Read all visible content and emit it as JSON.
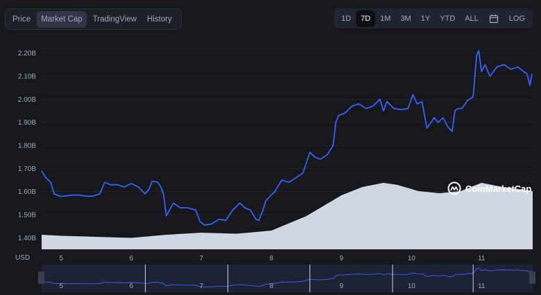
{
  "tabs": [
    {
      "label": "Price",
      "active": false
    },
    {
      "label": "Market Cap",
      "active": true
    },
    {
      "label": "TradingView",
      "active": false
    },
    {
      "label": "History",
      "active": false
    }
  ],
  "ranges": [
    "1D",
    "7D",
    "1M",
    "3M",
    "1Y",
    "YTD",
    "ALL"
  ],
  "active_range": "7D",
  "log_label": "LOG",
  "brand": "CoinMarketCap",
  "currency_label": "USD",
  "colors": {
    "line": "#3861fb",
    "volume": "#cfd6e4",
    "grid": "#23262e",
    "background": "#17181b"
  },
  "chart_data": {
    "type": "line",
    "y_unit": "B",
    "ylim": [
      1.35,
      2.25
    ],
    "y_ticks": [
      "2.20B",
      "2.10B",
      "2.00B",
      "1.90B",
      "1.80B",
      "1.70B",
      "1.60B",
      "1.50B",
      "1.40B"
    ],
    "y_tick_values": [
      2.2,
      2.1,
      2.0,
      1.9,
      1.8,
      1.7,
      1.6,
      1.5,
      1.4
    ],
    "x_ticks": [
      "5",
      "6",
      "7",
      "8",
      "9",
      "10",
      "11"
    ],
    "x_tick_values": [
      5,
      6,
      7,
      8,
      9,
      10,
      11
    ],
    "xlim": [
      4.72,
      11.73
    ],
    "series": [
      {
        "x": [
          4.72,
          4.78,
          4.85,
          4.9,
          4.98,
          5.05,
          5.15,
          5.25,
          5.35,
          5.45,
          5.55,
          5.62,
          5.7,
          5.8,
          5.9,
          6.0,
          6.1,
          6.2,
          6.25,
          6.3,
          6.38,
          6.42,
          6.46,
          6.5,
          6.6,
          6.7,
          6.8,
          6.92,
          6.98,
          7.05,
          7.15,
          7.25,
          7.35,
          7.45,
          7.55,
          7.62,
          7.7,
          7.78,
          7.82,
          7.88,
          7.92,
          7.98,
          8.05,
          8.15,
          8.25,
          8.35,
          8.45,
          8.55,
          8.62,
          8.7,
          8.8,
          8.88,
          8.92,
          8.96,
          9.05,
          9.15,
          9.25,
          9.35,
          9.45,
          9.55,
          9.6,
          9.65,
          9.75,
          9.85,
          9.95,
          10.02,
          10.08,
          10.15,
          10.22,
          10.28,
          10.32,
          10.38,
          10.45,
          10.52,
          10.58,
          10.62,
          10.66,
          10.72,
          10.8,
          10.88,
          10.93,
          10.96,
          11.0,
          11.05,
          11.12,
          11.22,
          11.32,
          11.42,
          11.52,
          11.6,
          11.65,
          11.69,
          11.72
        ],
        "values": [
          1.69,
          1.66,
          1.64,
          1.59,
          1.58,
          1.58,
          1.585,
          1.585,
          1.58,
          1.58,
          1.59,
          1.64,
          1.63,
          1.63,
          1.62,
          1.635,
          1.62,
          1.59,
          1.61,
          1.645,
          1.64,
          1.62,
          1.59,
          1.495,
          1.55,
          1.53,
          1.53,
          1.52,
          1.47,
          1.455,
          1.46,
          1.48,
          1.475,
          1.52,
          1.55,
          1.53,
          1.52,
          1.48,
          1.475,
          1.52,
          1.56,
          1.58,
          1.6,
          1.65,
          1.64,
          1.66,
          1.68,
          1.77,
          1.75,
          1.74,
          1.76,
          1.8,
          1.9,
          1.93,
          1.94,
          1.97,
          1.98,
          1.96,
          1.97,
          2.0,
          1.95,
          1.99,
          1.96,
          1.955,
          1.96,
          2.02,
          1.98,
          1.99,
          1.875,
          1.9,
          1.92,
          1.9,
          1.92,
          1.88,
          1.86,
          1.95,
          1.96,
          1.96,
          1.995,
          2.01,
          2.19,
          2.21,
          2.12,
          2.15,
          2.1,
          2.14,
          2.15,
          2.13,
          2.14,
          2.12,
          2.11,
          2.06,
          2.11
        ]
      }
    ],
    "volume_x": [
      4.72,
      5.0,
      5.5,
      6.0,
      6.5,
      7.0,
      7.5,
      8.0,
      8.5,
      9.0,
      9.3,
      9.6,
      9.8,
      10.1,
      10.4,
      10.7,
      11.0,
      11.3,
      11.73
    ],
    "volume_y": [
      0.7,
      0.65,
      0.6,
      0.55,
      0.7,
      0.8,
      0.75,
      0.9,
      1.6,
      2.6,
      3.0,
      3.2,
      3.1,
      2.8,
      2.7,
      2.8,
      3.2,
      3.0,
      2.8
    ],
    "volume_ylim": [
      0,
      10
    ]
  }
}
